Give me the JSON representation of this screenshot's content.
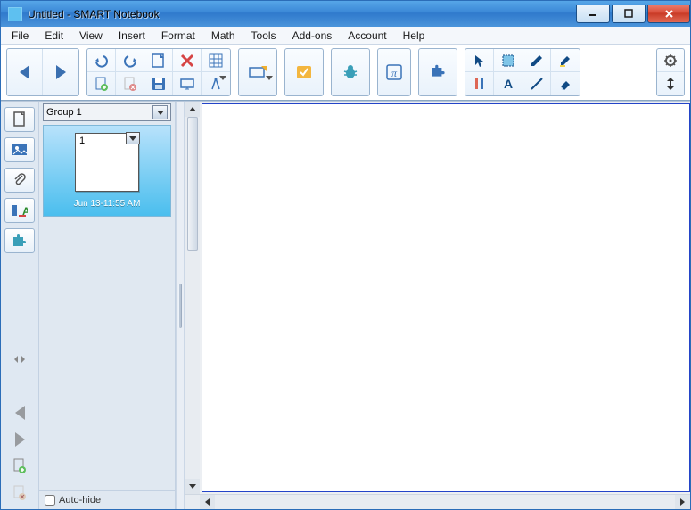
{
  "window": {
    "title": "Untitled - SMART Notebook"
  },
  "menu": {
    "items": [
      "File",
      "Edit",
      "View",
      "Insert",
      "Format",
      "Math",
      "Tools",
      "Add-ons",
      "Account",
      "Help"
    ]
  },
  "toolbar": {
    "nav_prev": "back-icon",
    "nav_next": "forward-icon"
  },
  "panel": {
    "group_label": "Group 1",
    "thumbs": [
      {
        "number": "1",
        "caption": "Jun 13-11:55 AM"
      }
    ],
    "autohide_label": "Auto-hide",
    "autohide_checked": false
  },
  "icons": {
    "cursor": "select-icon",
    "select": "area-select-icon",
    "pen": "pen-icon",
    "highlighter": "highlighter-icon",
    "ruler": "ruler-icon",
    "text": "text-icon",
    "line": "line-icon",
    "eraser": "eraser-icon",
    "math": "pi-icon",
    "puzzle": "puzzle-icon",
    "bug": "bug-icon",
    "check": "check-icon",
    "screen": "screen-icon",
    "undo": "undo-icon",
    "redo": "redo-icon",
    "new": "new-page-icon",
    "add": "add-page-icon",
    "delete": "delete-icon",
    "open": "open-icon",
    "save": "save-icon",
    "table": "table-icon",
    "projector": "screen-share-icon",
    "measure": "compass-icon",
    "gear": "gear-icon",
    "expand": "expand-icon"
  }
}
